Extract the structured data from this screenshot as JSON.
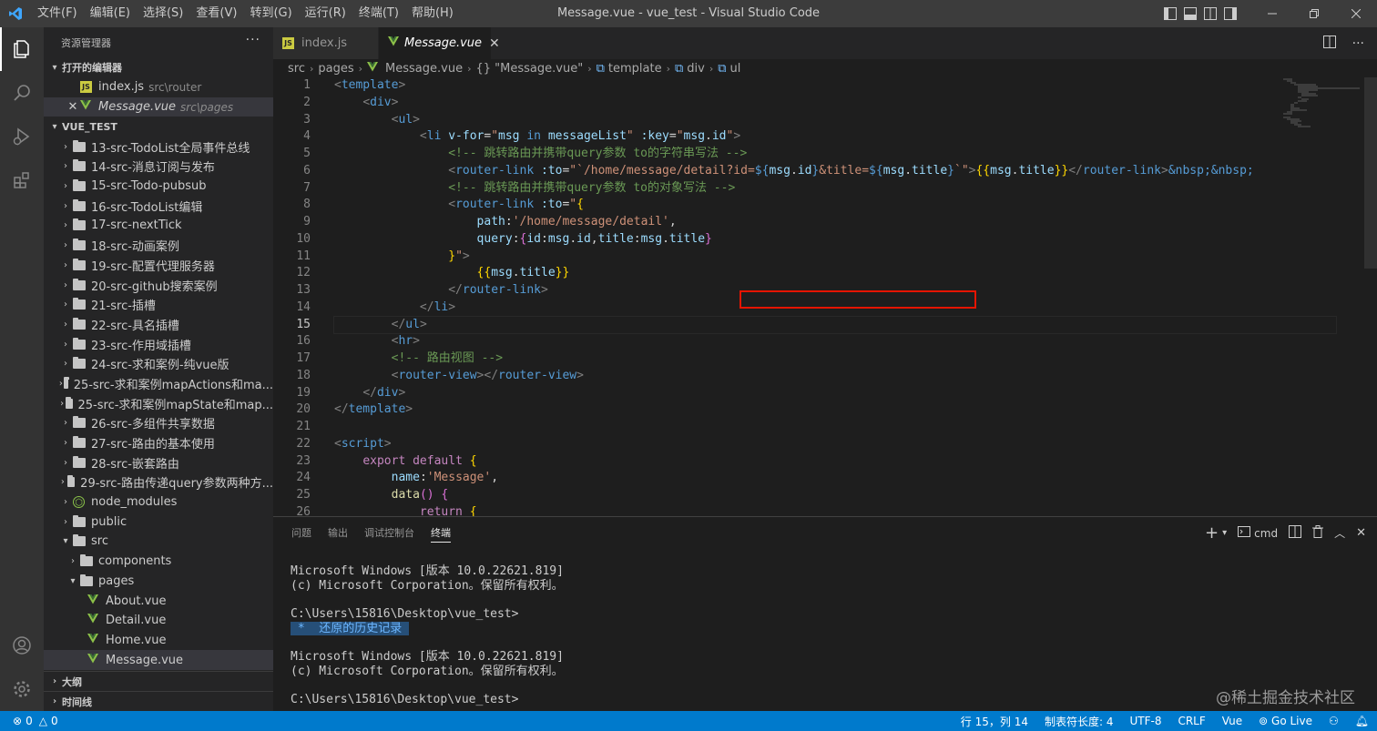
{
  "titlebar": {
    "menus": [
      "文件(F)",
      "编辑(E)",
      "选择(S)",
      "查看(V)",
      "转到(G)",
      "运行(R)",
      "终端(T)",
      "帮助(H)"
    ],
    "window_title": "Message.vue - vue_test - Visual Studio Code"
  },
  "sidebar": {
    "header": "资源管理器",
    "more": "···",
    "open_editors_title": "打开的编辑器",
    "open_editors": [
      {
        "name": "index.js",
        "desc": "src\\router",
        "icon": "js-icon"
      },
      {
        "name": "Message.vue",
        "desc": "src\\pages",
        "icon": "vue-icon"
      }
    ],
    "project_title": "VUE_TEST",
    "folders": [
      "13-src-TodoList全局事件总线",
      "14-src-消息订阅与发布",
      "15-src-Todo-pubsub",
      "16-src-TodoList编辑",
      "17-src-nextTick",
      "18-src-动画案例",
      "19-src-配置代理服务器",
      "20-src-github搜索案例",
      "21-src-插槽",
      "22-src-具名插槽",
      "23-src-作用域插槽",
      "24-src-求和案例-纯vue版",
      "25-src-求和案例mapActions和ma...",
      "25-src-求和案例mapState和map...",
      "26-src-多组件共享数据",
      "27-src-路由的基本使用",
      "28-src-嵌套路由",
      "29-src-路由传递query参数两种方..."
    ],
    "node_modules": "node_modules",
    "public": "public",
    "src": "src",
    "components": "components",
    "pages": "pages",
    "page_files": [
      "About.vue",
      "Detail.vue",
      "Home.vue",
      "Message.vue"
    ],
    "outline": "大纲",
    "timeline": "时间线"
  },
  "tabs": [
    {
      "name": "index.js",
      "icon": "js-icon"
    },
    {
      "name": "Message.vue",
      "icon": "vue-icon",
      "close": "✕"
    }
  ],
  "breadcrumb": [
    "src",
    "pages",
    "Message.vue",
    "{} \"Message.vue\"",
    "template",
    "div",
    "ul"
  ],
  "editor": {
    "line_numbers": [
      "1",
      "2",
      "3",
      "4",
      "5",
      "6",
      "7",
      "8",
      "9",
      "10",
      "11",
      "12",
      "13",
      "14",
      "15",
      "16",
      "17",
      "18",
      "19",
      "20",
      "21",
      "22",
      "23",
      "24",
      "25",
      "26"
    ],
    "current_line": "15"
  },
  "panel": {
    "tabs": [
      "问题",
      "输出",
      "调试控制台",
      "终端"
    ],
    "shell": "cmd",
    "terminal_lines": [
      "Microsoft Windows [版本 10.0.22621.819]",
      "(c) Microsoft Corporation。保留所有权利。",
      "",
      "C:\\Users\\15816\\Desktop\\vue_test>",
      " *  还原的历史记录 ",
      "",
      "Microsoft Windows [版本 10.0.22621.819]",
      "(c) Microsoft Corporation。保留所有权利。",
      "",
      "C:\\Users\\15816\\Desktop\\vue_test>"
    ],
    "watermark": "@稀土掘金技术社区"
  },
  "statusbar": {
    "errors": "0",
    "warnings": "0",
    "position": "行 15，列 14",
    "tab_size": "制表符长度: 4",
    "encoding": "UTF-8",
    "eol": "CRLF",
    "language": "Vue",
    "golive": "Go Live"
  },
  "colors": {
    "accent": "#007acc",
    "highlight_box": "#e51400",
    "vue_green": "#41b883",
    "js_yellow": "#cbcb41"
  }
}
